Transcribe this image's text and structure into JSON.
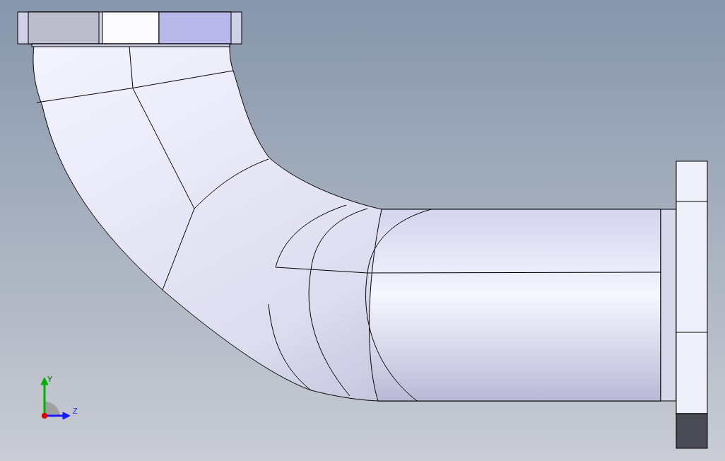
{
  "viewport": {
    "triad": {
      "axes": [
        {
          "label": "Y",
          "color": "#00b000"
        },
        {
          "label": "Z",
          "color": "#1a1aff"
        }
      ]
    }
  }
}
